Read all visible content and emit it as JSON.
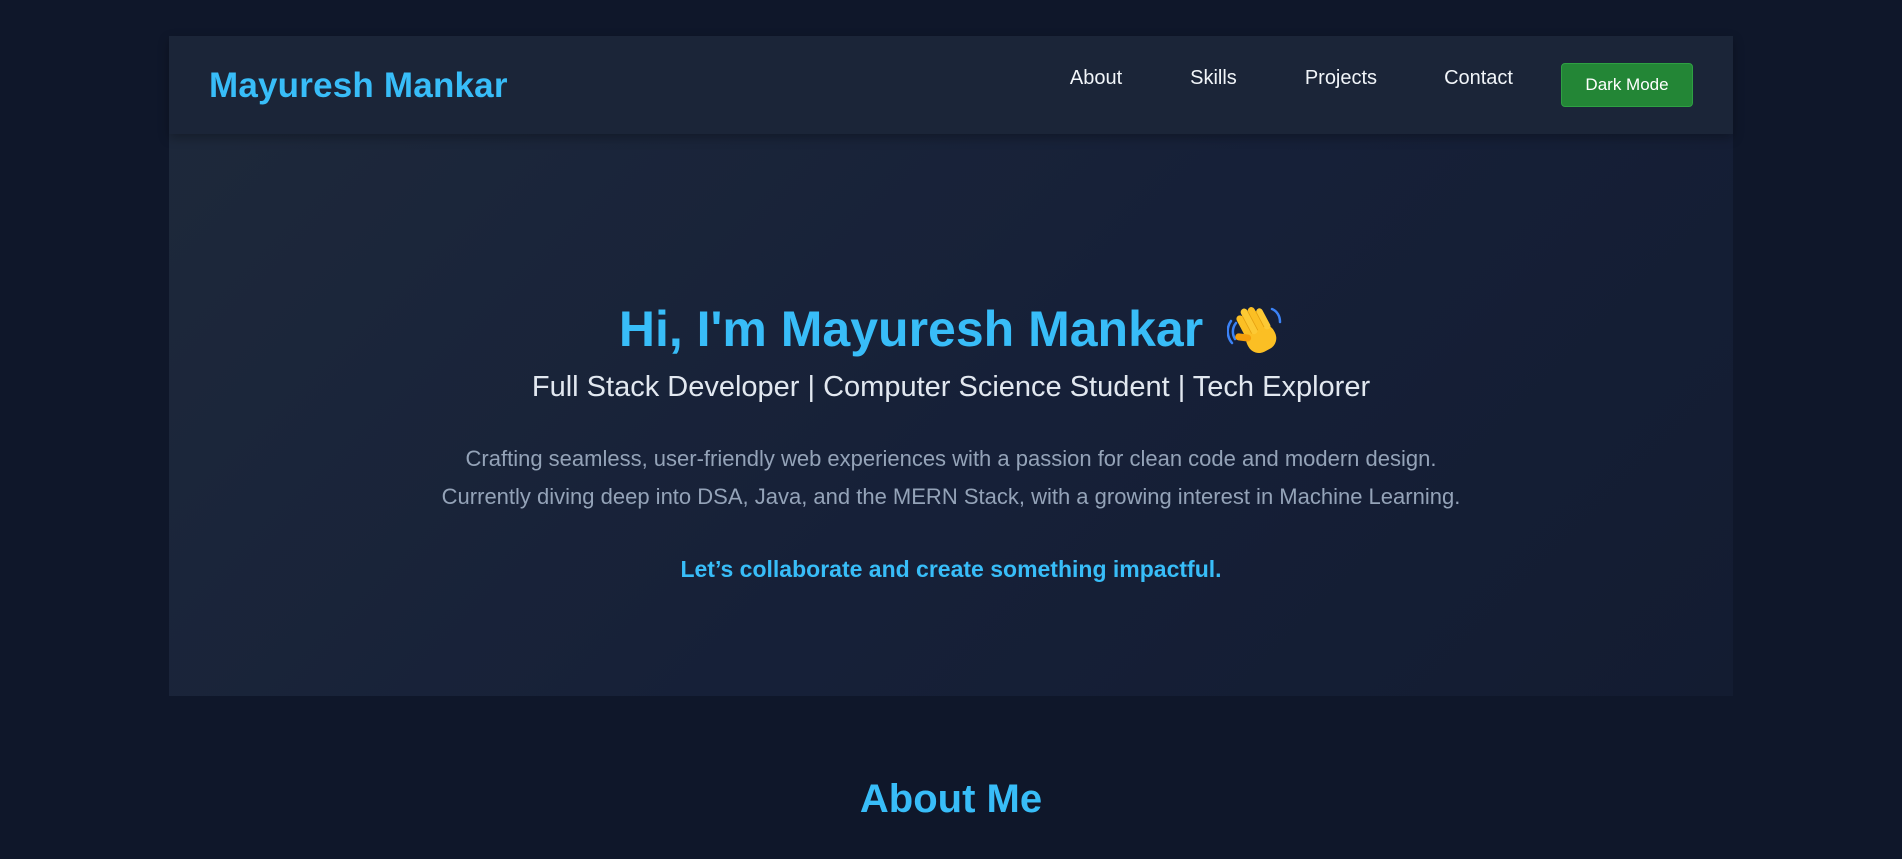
{
  "navbar": {
    "brand": "Mayuresh Mankar",
    "links": [
      "About",
      "Skills",
      "Projects",
      "Contact"
    ],
    "mode_button": "Dark Mode"
  },
  "hero": {
    "title": "Hi, I'm Mayuresh Mankar",
    "title_icon": "waving-hand-icon",
    "subtitle": "Full Stack Developer | Computer Science Student | Tech Explorer",
    "description_lines": [
      "Crafting seamless, user-friendly web experiences with a passion for clean code and modern design.",
      "Currently diving deep into DSA, Java, and the MERN Stack, with a growing interest in Machine Learning."
    ],
    "cta": "Let’s collaborate and create something impactful."
  },
  "about": {
    "heading": "About Me"
  },
  "colors": {
    "background": "#0f172a",
    "card": "#1e293b",
    "accent": "#38bdf8",
    "button": "#238636"
  }
}
